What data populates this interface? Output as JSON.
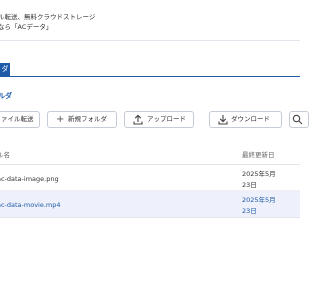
{
  "header": {
    "tagline_line1": "ル転送、無料クラウドストレージ",
    "tagline_line2": "なら「ACデータ」"
  },
  "tabs": [
    {
      "label": "ダ",
      "active": true
    }
  ],
  "breadcrumb": "ルダ",
  "toolbar": {
    "transfer_label": "ァイル転送",
    "new_folder_label": "新規フォルダ",
    "new_folder_icon": "+",
    "upload_label": "アップロード",
    "upload_icon": "upload-icon",
    "download_label": "ダウンロード",
    "download_icon": "download-icon",
    "search_icon": "search-icon"
  },
  "table": {
    "columns": [
      "ル名",
      "最終更新日"
    ],
    "rows": [
      {
        "name": "ac-data-image.png",
        "date": "2025年5月23日",
        "selected": false
      },
      {
        "name": "ac-data-movie.mp4",
        "date": "2025年5月23日",
        "selected": true
      }
    ]
  },
  "colors": {
    "accent": "#1e5aa8",
    "selected_row": "#eef1fb",
    "border": "#c5ccd6"
  }
}
